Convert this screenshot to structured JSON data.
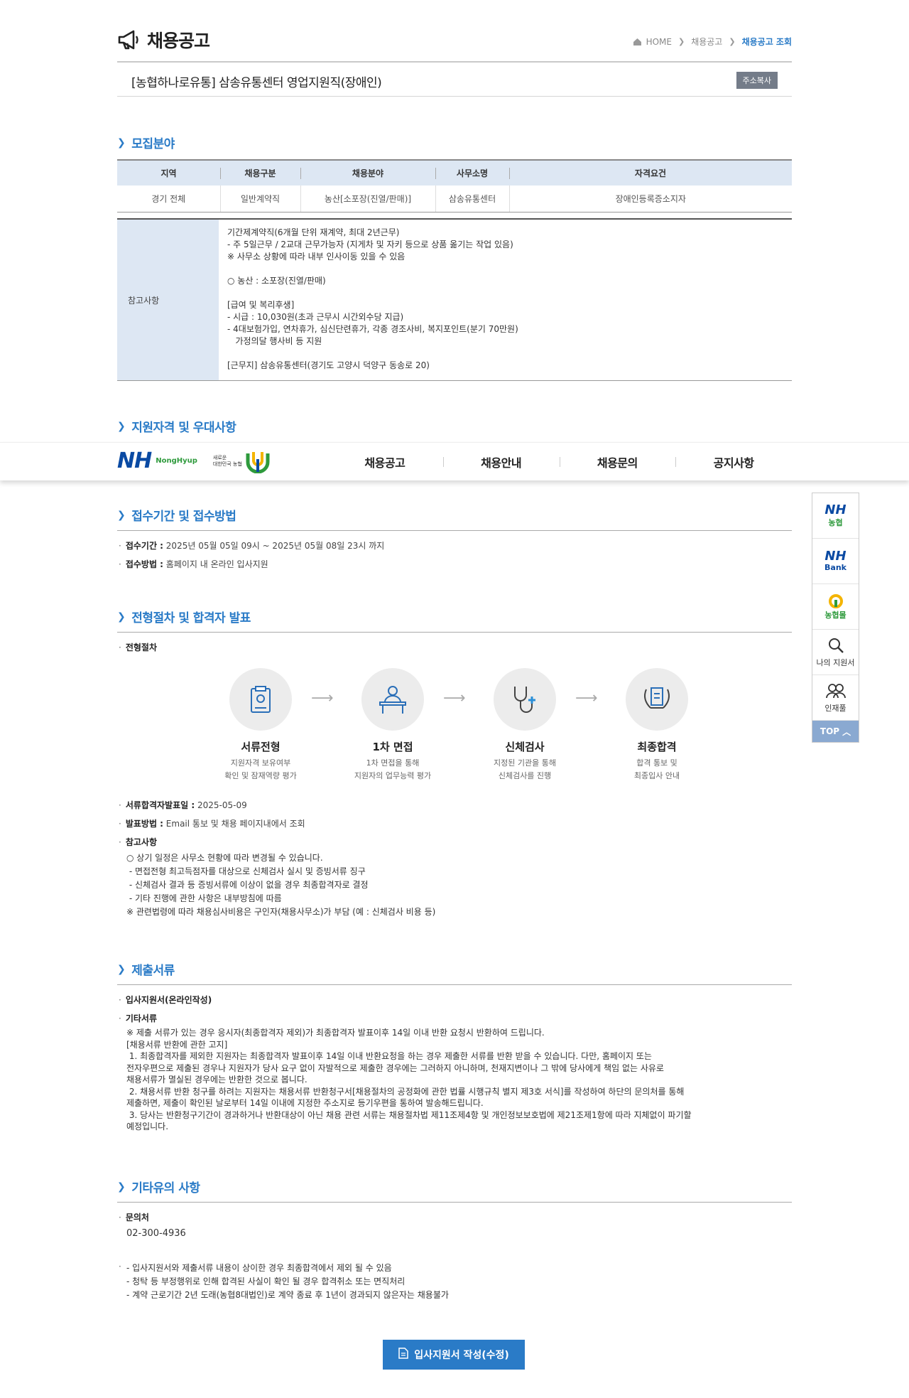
{
  "header": {
    "title": "채용공고",
    "breadcrumb": [
      "HOME",
      "채용공고",
      "채용공고 조회"
    ]
  },
  "job": {
    "title": "[농협하나로유통] 삼송유통센터 영업지원직(장애인)",
    "copy_label": "주소복사"
  },
  "sections": {
    "recruit": "모집분야",
    "qualification": "지원자격 및 우대사항",
    "period": "접수기간 및 접수방법",
    "process": "전형절차 및 합격자 발표",
    "documents": "제출서류",
    "etc": "기타유의 사항"
  },
  "recruit_table": {
    "headers": [
      "지역",
      "채용구분",
      "채용분야",
      "사무소명",
      "자격요건"
    ],
    "rows": [
      [
        "경기 전체",
        "일반계약직",
        "농산[소포장(진열/판매)]",
        "삼송유통센터",
        "장애인등록증소지자"
      ]
    ]
  },
  "note": {
    "label": "참고사항",
    "text": "기간제계약직(6개월 단위 재계약, 최대 2년근무)\n- 주 5일근무 / 2교대 근무가능자 (지게차 및 자키 등으로 상품 옮기는 작업 있음)\n※ 사무소 상황에 따라 내부 인사이동 있을 수 있음\n\n○ 농산 : 소포장(진열/판매)\n\n[급여 및 복리후생]\n- 시급 : 10,030원(초과 근무시 시간외수당 지급)\n- 4대보험가입, 연차휴가, 심신단련휴가, 각종 경조사비, 복지포인트(분기 70만원)\n   가정의달 행사비 등 지원\n\n[근무지] 삼송유통센터(경기도 고양시 덕양구 동송로 20)"
  },
  "nav": {
    "logo": "NH",
    "logo_sub": "NongHyup",
    "logo_sub2": "새로운\n대한민국 농협",
    "menu": [
      "채용공고",
      "채용안내",
      "채용문의",
      "공지사항"
    ]
  },
  "quick": {
    "items": [
      {
        "big": "NH",
        "small": "농협"
      },
      {
        "big": "NH",
        "small": "Bank"
      },
      {
        "big": "",
        "small": "농협몰"
      },
      {
        "big": "",
        "small": "나의 지원서"
      },
      {
        "big": "",
        "small": "인재풀"
      }
    ],
    "top": "TOP"
  },
  "period": {
    "period_label": "접수기간 :",
    "period_value": "2025년 05월 05일 09시 ~ 2025년 05월 08일 23시 까지",
    "method_label": "접수방법 :",
    "method_value": "홈페이지 내 온라인 입사지원"
  },
  "process": {
    "label": "전형절차",
    "steps": [
      {
        "name": "서류전형",
        "desc1": "지원자격 보유여부",
        "desc2": "확인 및 잠재역량 평가"
      },
      {
        "name": "1차 면접",
        "desc1": "1차 면접을 통해",
        "desc2": "지원자의 업무능력 평가"
      },
      {
        "name": "신체검사",
        "desc1": "지정된 기관을 통해",
        "desc2": "신체검사를 진행"
      },
      {
        "name": "최종합격",
        "desc1": "합격 통보 및",
        "desc2": "최종입사 안내"
      }
    ],
    "doc_pass_label": "서류합격자발표일 :",
    "doc_pass_value": "2025-05-09",
    "announce_label": "발표방법 :",
    "announce_value": "Email 통보 및 채용 페이지내에서 조회",
    "notes_label": "참고사항",
    "notes_text": "○ 상기 일정은 사무소 현황에 따라 변경될 수 있습니다.\n - 면접전형 최고득점자를 대상으로 신체검사 실시 및 증빙서류 징구\n - 신체검사 결과 등 증빙서류에 이상이 없을 경우 최종합격자로 결정\n - 기타 진행에 관한 사항은 내부방침에 따름\n※ 관련법령에 따라 채용심사비용은 구인자(채용사무소)가 부담 (예 : 신체검사 비용 등)"
  },
  "documents": {
    "item1": "입사지원서(온라인작성)",
    "item2": "기타서류",
    "text": "※ 제출 서류가 있는 경우 응시자(최종합격자 제외)가 최종합격자 발표이후 14일 이내 반환 요청시 반환하여 드립니다.\n[채용서류 반환에 관한 고지]\n 1. 최종합격자를 제외한 지원자는 최종합격자 발표이후 14일 이내 반환요청을 하는 경우 제출한 서류를 반환 받을 수 있습니다. 다만, 홈페이지 또는\n전자우편으로 제출된 경우나 지원자가 당사 요구 없이 자발적으로 제출한 경우에는 그러하지 아니하며, 천재지변이나 그 밖에 당사에게 책임 없는 사유로\n채용서류가 멸실된 경우에는 반환한 것으로 봅니다.\n 2. 채용서류 반환 청구를 하려는 지원자는 채용서류 반환청구서[채용절차의 공정화에 관한 법률 시행규칙 별지 제3호 서식]를 작성하여 하단의 문의처를 통해\n제출하면, 제출이 확인된 날로부터 14일 이내에 지정한 주소지로 등기우편을 통하여 발송해드립니다.\n 3. 당사는 반환청구기간이 경과하거나 반환대상이 아닌 채용 관련 서류는 채용절차법 제11조제4항 및 개인정보보호법에 제21조제1항에 따라 지체없이 파기할\n예정입니다."
  },
  "etc": {
    "contact_label": "문의처",
    "contact_value": "02-300-4936",
    "notes": "- 입사지원서와 제출서류 내용이 상이한 경우 최종합격에서 제외 될 수 있음\n- 청탁 등 부정행위로 인해 합격된 사실이 확인 될 경우 합격취소 또는 면직처리\n- 계약 근로기간 2년 도래(농협8대법인)로 계약 종료 후 1년이 경과되지 않은자는 채용불가"
  },
  "apply_button": "입사지원서 작성(수정)",
  "colors": {
    "accent": "#2a7bc7",
    "table_header": "#dde7f3",
    "brand": "#0a4aa3"
  }
}
